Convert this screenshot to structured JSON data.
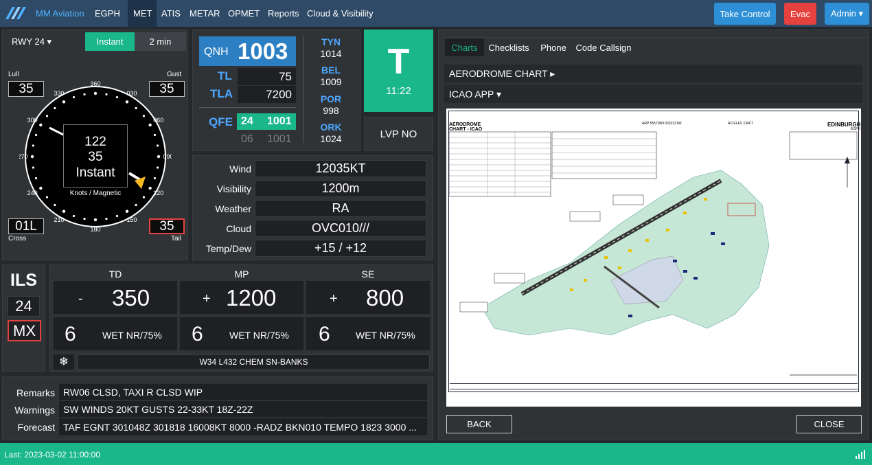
{
  "nav": {
    "brand": "MM Aviation",
    "items": [
      "EGPH",
      "MET",
      "ATIS",
      "METAR",
      "OPMET",
      "Reports",
      "Cloud & Visibility"
    ],
    "active": "MET",
    "take_control": "Take Control",
    "evac": "Evac",
    "admin": "Admin ▾"
  },
  "wind": {
    "runway": "RWY 24 ▾",
    "mode_instant": "Instant",
    "mode_2min": "2 min",
    "lull_label": "Lull",
    "lull": "35",
    "gust_label": "Gust",
    "gust": "35",
    "cross_label": "Cross",
    "cross": "01L",
    "tail_label": "Tail",
    "tail": "35",
    "dir": "122",
    "speed": "35",
    "mode": "Instant",
    "units": "Knots / Magnetic",
    "dial_labels": [
      "360",
      "030",
      "060",
      "090",
      "120",
      "150",
      "180",
      "210",
      "240",
      "270",
      "300",
      "330"
    ]
  },
  "pressure": {
    "qnh_label": "QNH",
    "qnh": "1003",
    "tl_label": "TL",
    "tl": "75",
    "tla_label": "TLA",
    "tla": "7200",
    "qfe_label": "QFE",
    "qfe_rwy1": "24",
    "qfe_val1": "1001",
    "qfe_rwy2": "06",
    "qfe_val2": "1001",
    "stations": [
      {
        "name": "TYN",
        "value": "1014"
      },
      {
        "name": "BEL",
        "value": "1009"
      },
      {
        "name": "POR",
        "value": "998"
      },
      {
        "name": "ORK",
        "value": "1024"
      }
    ]
  },
  "atis": {
    "letter": "T",
    "time": "11:22",
    "lvp": "LVP NO"
  },
  "met": [
    {
      "label": "Wind",
      "value": "12035KT"
    },
    {
      "label": "Visibility",
      "value": "1200m"
    },
    {
      "label": "Weather",
      "value": "RA"
    },
    {
      "label": "Cloud",
      "value": "OVC010///"
    },
    {
      "label": "Temp/Dew",
      "value": "+15 / +12"
    }
  ],
  "ils": {
    "title": "ILS",
    "rwy": "24",
    "mx": "MX"
  },
  "rvr": {
    "headers": [
      "TD",
      "MP",
      "SE"
    ],
    "trends": [
      "-",
      "+",
      "+"
    ],
    "values": [
      "350",
      "1200",
      "800"
    ],
    "codes": [
      "6",
      "6",
      "6"
    ],
    "states": [
      "WET NR/75%",
      "WET NR/75%",
      "WET NR/75%"
    ],
    "snow_text": "W34 L432 CHEM SN-BANKS"
  },
  "remarks": [
    {
      "label": "Remarks",
      "value": "RW06 CLSD, TAXI R CLSD WIP"
    },
    {
      "label": "Warnings",
      "value": "SW WINDS 20KT GUSTS 22-33KT 18Z-22Z"
    },
    {
      "label": "Forecast",
      "value": "TAF EGNT 301048Z 301818 16008KT 8000 -RADZ BKN010 TEMPO 1823 3000 ..."
    }
  ],
  "charts": {
    "tabs": [
      "Charts",
      "Checklists",
      "Phone",
      "Code Callsign"
    ],
    "aerodrome": "AERODROME CHART ▸",
    "icao_app": "ICAO APP ▾",
    "chart_title1": "AERODROME",
    "chart_title2": "CHART - ICAO",
    "chart_arp": "ARP 555700N 0032221W",
    "chart_elev": "AD ELEV 136FT",
    "chart_city": "EDINBURGH",
    "chart_code": "EGPH",
    "back": "BACK",
    "close": "CLOSE"
  },
  "footer": {
    "last": "Last: 2023-03-02 11:00:00"
  },
  "colors": {
    "nav": "#2f4a66",
    "green": "#19b789",
    "blue": "#2d7fc3",
    "red": "#e5423f",
    "panel": "#303336"
  }
}
